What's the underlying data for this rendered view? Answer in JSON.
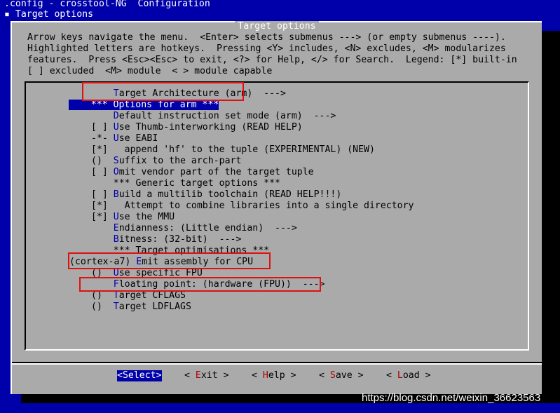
{
  "header": {
    "line1": ".config - crosstool-NG  Configuration",
    "line2_bullet": "▪",
    "line2": " Target options"
  },
  "dialog": {
    "title": "Target options",
    "help": [
      "Arrow keys navigate the menu.  <Enter> selects submenus ---> (or empty submenus ----).",
      "Highlighted letters are hotkeys.  Pressing <Y> includes, <N> excludes, <M> modularizes",
      "features.  Press <Esc><Esc> to exit, <?> for Help, </> for Search.  Legend: [*] built-in",
      "[ ] excluded  <M> module  < > module capable"
    ]
  },
  "menu": {
    "items": [
      {
        "prefix": "    ",
        "hot": "T",
        "rest": "arget Architecture (arm)  --->"
      },
      {
        "prefix": "    ",
        "hot": "",
        "rest": "*** Options for arm ***",
        "selected": true
      },
      {
        "prefix": "    ",
        "hot": "D",
        "rest": "efault instruction set mode (arm)  --->"
      },
      {
        "prefix": "[ ] ",
        "hot": "U",
        "rest": "se Thumb-interworking (READ HELP)"
      },
      {
        "prefix": "-*- ",
        "hot": "U",
        "rest": "se EABI"
      },
      {
        "prefix": "[*] ",
        "hot": "",
        "rest": "  append 'hf' to the tuple (EXPERIMENTAL) (NEW)"
      },
      {
        "prefix": "()  ",
        "hot": "S",
        "rest": "uffix to the arch-part"
      },
      {
        "prefix": "[ ] ",
        "hot": "O",
        "rest": "mit vendor part of the target tuple"
      },
      {
        "prefix": "    ",
        "hot": "",
        "rest": "*** Generic target options ***"
      },
      {
        "prefix": "[ ] ",
        "hot": "B",
        "rest": "uild a multilib toolchain (READ HELP!!!)"
      },
      {
        "prefix": "[*] ",
        "hot": "",
        "rest": "  Attempt to combine libraries into a single directory"
      },
      {
        "prefix": "[*] ",
        "hot": "U",
        "rest": "se the MMU"
      },
      {
        "prefix": "    ",
        "hot": "E",
        "rest": "ndianness: (Little endian)  --->"
      },
      {
        "prefix": "    ",
        "hot": "B",
        "rest": "itness: (32-bit)  --->"
      },
      {
        "prefix": "    ",
        "hot": "",
        "rest": "*** Target optimisations ***"
      },
      {
        "prefix": "(cortex-a7) ",
        "hot": "E",
        "rest": "mit assembly for CPU",
        "wide": true
      },
      {
        "prefix": "()  ",
        "hot": "U",
        "rest": "se specific FPU"
      },
      {
        "prefix": "    ",
        "hot": "F",
        "rest": "loating point: (hardware (FPU))  --->"
      },
      {
        "prefix": "()  ",
        "hot": "T",
        "rest": "arget CFLAGS"
      },
      {
        "prefix": "()  ",
        "hot": "T",
        "rest": "arget LDFLAGS"
      }
    ]
  },
  "buttons": {
    "select": "<Select>",
    "exit": {
      "l": "< ",
      "hk": "E",
      "r": "xit >"
    },
    "help": {
      "l": "< ",
      "hk": "H",
      "r": "elp >"
    },
    "save": {
      "l": "< ",
      "hk": "S",
      "r": "ave >"
    },
    "load": {
      "l": "< ",
      "hk": "L",
      "r": "oad >"
    }
  },
  "watermark": "https://blog.csdn.net/weixin_36623563"
}
